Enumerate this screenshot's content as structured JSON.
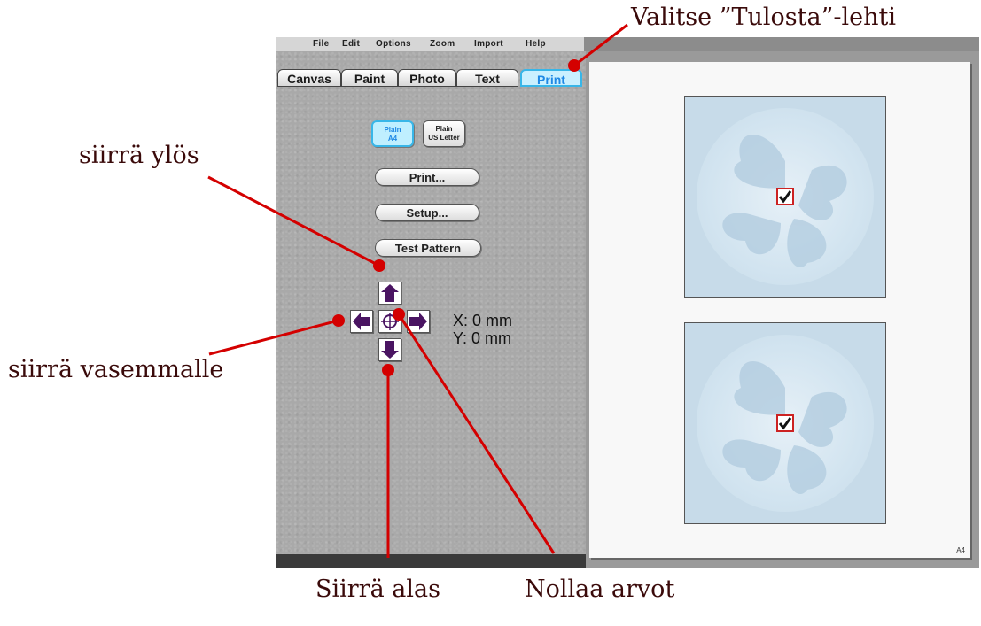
{
  "menu": [
    "File",
    "Edit",
    "Options",
    "Zoom",
    "Import",
    "Help"
  ],
  "tabs": [
    {
      "label": "Canvas",
      "active": false
    },
    {
      "label": "Paint",
      "active": false
    },
    {
      "label": "Photo",
      "active": false
    },
    {
      "label": "Text",
      "active": false
    },
    {
      "label": "Print",
      "active": true
    }
  ],
  "paper": {
    "a4": {
      "line1": "Plain",
      "line2": "A4",
      "selected": true
    },
    "us_letter": {
      "line1": "Plain",
      "line2": "US Letter",
      "selected": false
    }
  },
  "buttons": {
    "print": "Print...",
    "setup": "Setup...",
    "test_pattern": "Test Pattern"
  },
  "offset": {
    "x_text": "X: 0 mm",
    "y_text": "Y: 0 mm"
  },
  "preview": {
    "page_size_label": "A4"
  },
  "annotations": {
    "select_print_tab": "Valitse ”Tulosta”-lehti",
    "move_up": "siirrä ylös",
    "move_left": "siirrä vasemmalle",
    "move_down": "Siirrä alas",
    "reset_values": "Nollaa arvot"
  },
  "colors": {
    "annotation_line": "#d40000",
    "arrow_fill": "#4a1462",
    "active_tab": "#38b6e8"
  },
  "icons": {
    "up": "arrow-up-icon",
    "down": "arrow-down-icon",
    "left": "arrow-left-icon",
    "right": "arrow-right-icon",
    "center": "crosshair-icon",
    "check": "checkmark-icon"
  }
}
